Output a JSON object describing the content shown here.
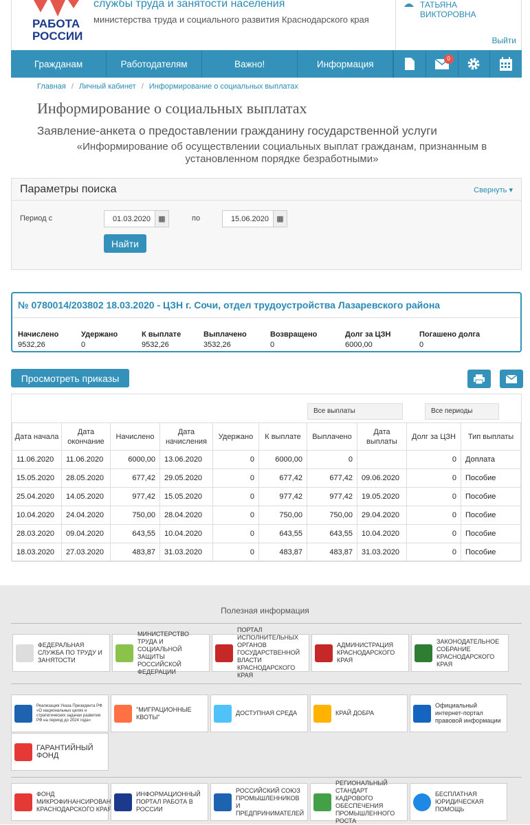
{
  "header": {
    "logo_line1": "РАБОТА",
    "logo_line2": "РОССИИ",
    "org_line1": "службы труда и занятости населения",
    "org_line2": "министерства труда и социального развития Краснодарского края",
    "user_line1": "ТАТЬЯНА",
    "user_line2": "ВИКТОРОВНА",
    "logout": "Выйти"
  },
  "nav": {
    "items": [
      "Гражданам",
      "Работодателям",
      "Важно!",
      "Информация"
    ],
    "mail_badge": "0",
    "icons": [
      "document-icon",
      "mail-icon",
      "gear-icon",
      "calendar-icon"
    ]
  },
  "breadcrumb": [
    "Главная",
    "Личный кабинет",
    "Информирование о социальных выплатах"
  ],
  "page": {
    "title": "Информирование о социальных выплатах",
    "subtitle": "Заявление-анкета о предоставлении гражданину государственной услуги",
    "subtitle2": "«Информирование об осуществлении социальных выплат гражданам, признанным в установленном порядке безработными»"
  },
  "search": {
    "title": "Параметры поиска",
    "collapse": "Свернуть",
    "period_label": "Период с",
    "from": "01.03.2020",
    "to_label": "по",
    "to": "15.06.2020",
    "find": "Найти"
  },
  "result": {
    "title": "№ 0780014/203802 18.03.2020 - ЦЗН г. Сочи, отдел трудоустройства Лазаревского района",
    "fields": [
      {
        "label": "Начислено",
        "value": "9532,26"
      },
      {
        "label": "Удержано",
        "value": "0"
      },
      {
        "label": "К выплате",
        "value": "9532,26"
      },
      {
        "label": "Выплачено",
        "value": "3532,26"
      },
      {
        "label": "Возвращено",
        "value": "0"
      },
      {
        "label": "Долг за ЦЗН",
        "value": "6000,00"
      },
      {
        "label": "Погашено долга",
        "value": "0"
      }
    ]
  },
  "orders_button": "Просмотреть приказы",
  "filters": {
    "payments": "Все выплаты",
    "periods": "Все периоды"
  },
  "table": {
    "headers": [
      "Дата начала",
      "Дата окончание",
      "Начислено",
      "Дата начисления",
      "Удержано",
      "К выплате",
      "Выплачено",
      "Дата выплаты",
      "Долг за ЦЗН",
      "Тип выплаты"
    ],
    "rows": [
      [
        "11.06.2020",
        "11.06.2020",
        "6000,00",
        "13.06.2020",
        "0",
        "6000,00",
        "0",
        "",
        "0",
        "Доплата"
      ],
      [
        "15.05.2020",
        "28.05.2020",
        "677,42",
        "29.05.2020",
        "0",
        "677,42",
        "677,42",
        "09.06.2020",
        "0",
        "Пособие"
      ],
      [
        "25.04.2020",
        "14.05.2020",
        "977,42",
        "15.05.2020",
        "0",
        "977,42",
        "977,42",
        "19.05.2020",
        "0",
        "Пособие"
      ],
      [
        "10.04.2020",
        "24.04.2020",
        "750,00",
        "28.04.2020",
        "0",
        "750,00",
        "750,00",
        "29.04.2020",
        "0",
        "Пособие"
      ],
      [
        "28.03.2020",
        "09.04.2020",
        "643,55",
        "10.04.2020",
        "0",
        "643,55",
        "643,55",
        "10.04.2020",
        "0",
        "Пособие"
      ],
      [
        "18.03.2020",
        "27.03.2020",
        "483,87",
        "31.03.2020",
        "0",
        "483,87",
        "483,87",
        "31.03.2020",
        "0",
        "Пособие"
      ]
    ]
  },
  "footer": {
    "title": "Полезная информация",
    "partners_row1": [
      "ФЕДЕРАЛЬНАЯ СЛУЖБА ПО ТРУДУ И ЗАНЯТОСТИ",
      "МИНИСТЕРСТВО ТРУДА И СОЦИАЛЬНОЙ ЗАЩИТЫ РОССИЙСКОЙ ФЕДЕРАЦИИ",
      "ПОРТАЛ ИСПОЛНИТЕЛЬНЫХ ОРГАНОВ ГОСУДАРСТВЕННОЙ ВЛАСТИ КРАСНОДАРСКОГО КРАЯ",
      "АДМИНИСТРАЦИЯ КРАСНОДАРСКОГО КРАЯ",
      "ЗАКОНОДАТЕЛЬНОЕ СОБРАНИЕ КРАСНОДАРСКОГО КРАЯ"
    ],
    "partners_row2": [
      "Реализация Указа Президента РФ «О национальных целях и стратегических задачах развития РФ на период до 2024 года»",
      "\"МИГРАЦИОННЫЕ КВОТЫ\"",
      "ДОСТУПНАЯ СРЕДА",
      "КРАЙ ДОБРА",
      "Официальный интернет-портал правовой информации"
    ],
    "partners_row3": [
      "ГАРАНТИЙНЫЙ ФОНД"
    ],
    "partners_row4": [
      "ФОНД МИКРОФИНАНСИРОВАНИЯ КРАСНОДАРСКОГО КРАЯ",
      "ИНФОРМАЦИОННЫЙ ПОРТАЛ РАБОТА В РОССИИ",
      "РОССИЙСКИЙ СОЮЗ ПРОМЫШЛЕННИКОВ И ПРЕДПРИНИМАТЕЛЕЙ",
      "РЕГИОНАЛЬНЫЙ СТАНДАРТ КАДРОВОГО ОБЕСПЕЧЕНИЯ ПРОМЫШЛЕННОГО РОСТА",
      "БЕСПЛАТНАЯ ЮРИДИЧЕСКАЯ ПОМОЩЬ"
    ],
    "colors": {
      "accent": "#3491b9",
      "brand_red": "#e4574d",
      "brand_blue": "#1b3a8c"
    }
  }
}
